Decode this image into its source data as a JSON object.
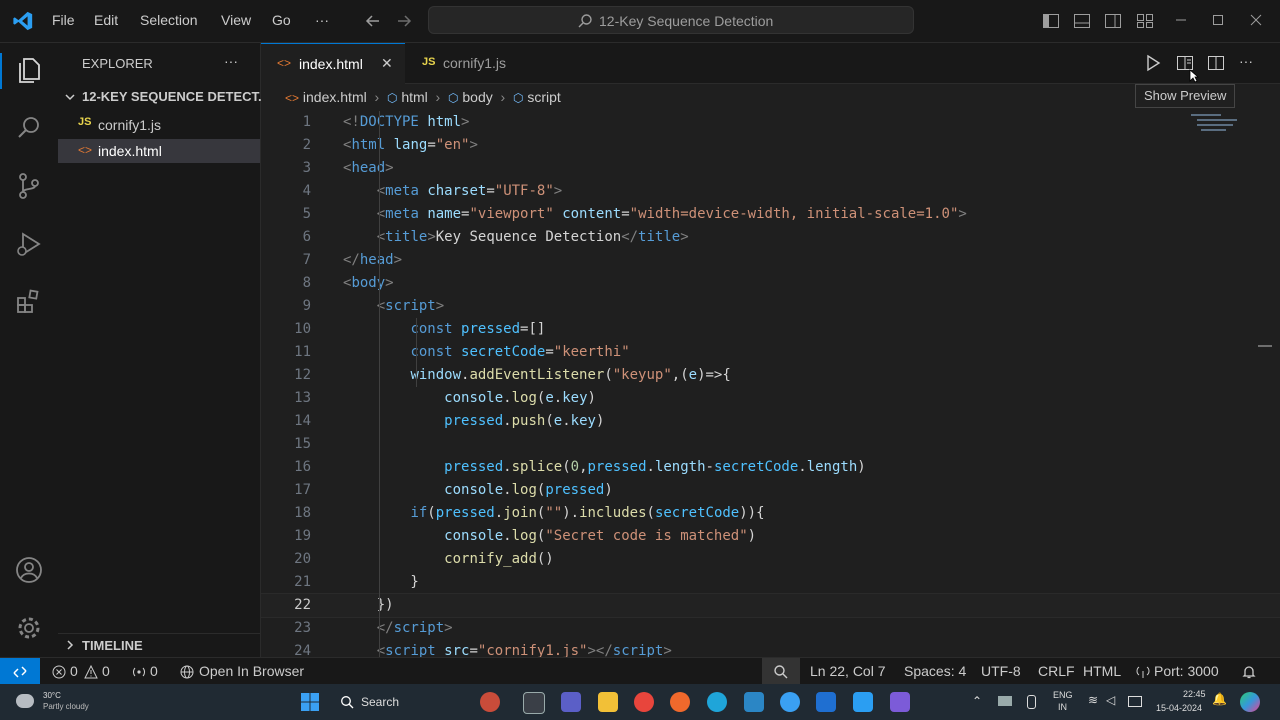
{
  "menu": {
    "file": "File",
    "edit": "Edit",
    "selection": "Selection",
    "view": "View",
    "go": "Go",
    "more": "···"
  },
  "search": {
    "text": "12-Key Sequence Detection"
  },
  "explorer": {
    "title": "EXPLORER",
    "more": "···",
    "folder": "12-KEY SEQUENCE DETECT...",
    "files": [
      "cornify1.js",
      "index.html"
    ],
    "timeline": "TIMELINE"
  },
  "tabs": [
    {
      "label": "index.html",
      "close": "✕"
    },
    {
      "label": "cornify1.js"
    }
  ],
  "breadcrumb": [
    "index.html",
    "html",
    "body",
    "script"
  ],
  "tooltip": "Show Preview",
  "code": [
    {
      "n": "1",
      "h": "<span class='tg'>&lt;!</span><span class='tn'>DOCTYPE</span> <span class='at'>html</span><span class='tg'>&gt;</span>"
    },
    {
      "n": "2",
      "h": "<span class='tg'>&lt;</span><span class='tn'>html</span> <span class='at'>lang</span>=<span class='st'>\"en\"</span><span class='tg'>&gt;</span>"
    },
    {
      "n": "3",
      "h": "<span class='tg'>&lt;</span><span class='tn'>head</span><span class='tg'>&gt;</span>"
    },
    {
      "n": "4",
      "h": "    <span class='tg'>&lt;</span><span class='tn'>meta</span> <span class='at'>charset</span>=<span class='st'>\"UTF-8\"</span><span class='tg'>&gt;</span>"
    },
    {
      "n": "5",
      "h": "    <span class='tg'>&lt;</span><span class='tn'>meta</span> <span class='at'>name</span>=<span class='st'>\"viewport\"</span> <span class='at'>content</span>=<span class='st'>\"width=device-width, initial-scale=1.0\"</span><span class='tg'>&gt;</span>"
    },
    {
      "n": "6",
      "h": "    <span class='tg'>&lt;</span><span class='tn'>title</span><span class='tg'>&gt;</span><span class='tx'>Key Sequence Detection</span><span class='tg'>&lt;/</span><span class='tn'>title</span><span class='tg'>&gt;</span>"
    },
    {
      "n": "7",
      "h": "<span class='tg'>&lt;/</span><span class='tn'>head</span><span class='tg'>&gt;</span>"
    },
    {
      "n": "8",
      "h": "<span class='tg'>&lt;</span><span class='tn'>body</span><span class='tg'>&gt;</span>"
    },
    {
      "n": "9",
      "h": "    <span class='tg'>&lt;</span><span class='tn'>script</span><span class='tg'>&gt;</span>"
    },
    {
      "n": "10",
      "h": "        <span class='kw'>const</span> <span class='vr'>pressed</span>=[]"
    },
    {
      "n": "11",
      "h": "        <span class='kw'>const</span> <span class='vr'>secretCode</span>=<span class='st'>\"keerthi\"</span>"
    },
    {
      "n": "12",
      "h": "        <span class='vb'>window</span>.<span class='fn'>addEventListener</span>(<span class='st'>\"keyup\"</span>,(<span class='vb'>e</span>)=&gt;{"
    },
    {
      "n": "13",
      "h": "            <span class='vb'>console</span>.<span class='fn'>log</span>(<span class='vb'>e</span>.<span class='vb'>key</span>)"
    },
    {
      "n": "14",
      "h": "            <span class='vr'>pressed</span>.<span class='fn'>push</span>(<span class='vb'>e</span>.<span class='vb'>key</span>)"
    },
    {
      "n": "15",
      "h": ""
    },
    {
      "n": "16",
      "h": "            <span class='vr'>pressed</span>.<span class='fn'>splice</span>(<span class='nm'>0</span>,<span class='vr'>pressed</span>.<span class='vb'>length</span>-<span class='vr'>secretCode</span>.<span class='vb'>length</span>)"
    },
    {
      "n": "17",
      "h": "            <span class='vb'>console</span>.<span class='fn'>log</span>(<span class='vr'>pressed</span>)"
    },
    {
      "n": "18",
      "h": "        <span class='kw'>if</span>(<span class='vr'>pressed</span>.<span class='fn'>join</span>(<span class='st'>\"\"</span>).<span class='fn'>includes</span>(<span class='vr'>secretCode</span>)){"
    },
    {
      "n": "19",
      "h": "            <span class='vb'>console</span>.<span class='fn'>log</span>(<span class='st'>\"Secret code is matched\"</span>)"
    },
    {
      "n": "20",
      "h": "            <span class='fn'>cornify_add</span>()"
    },
    {
      "n": "21",
      "h": "        }"
    },
    {
      "n": "22",
      "h": "    })"
    },
    {
      "n": "23",
      "h": "    <span class='tg'>&lt;/</span><span class='tn'>script</span><span class='tg'>&gt;</span>"
    },
    {
      "n": "24",
      "h": "    <span class='tg'>&lt;</span><span class='tn'>script</span> <span class='at'>src</span>=<span class='st'>\"cornify1.js\"</span><span class='tg'>&gt;&lt;/</span><span class='tn'>script</span><span class='tg'>&gt;</span>"
    }
  ],
  "status": {
    "errors": "0",
    "warnings": "0",
    "ports": "0",
    "open_browser": "Open In Browser",
    "position": "Ln 22, Col 7",
    "spaces": "Spaces: 4",
    "encoding": "UTF-8",
    "eol": "CRLF",
    "lang": "HTML",
    "port": "Port: 3000"
  },
  "taskbar": {
    "weather_temp": "30°C",
    "weather_desc": "Partly cloudy",
    "search": "Search",
    "lang1": "ENG",
    "lang2": "IN",
    "time": "22:45",
    "date": "15-04-2024"
  },
  "colors": {
    "accent": "#0078d4",
    "tab_active": "#1f1f1f"
  }
}
